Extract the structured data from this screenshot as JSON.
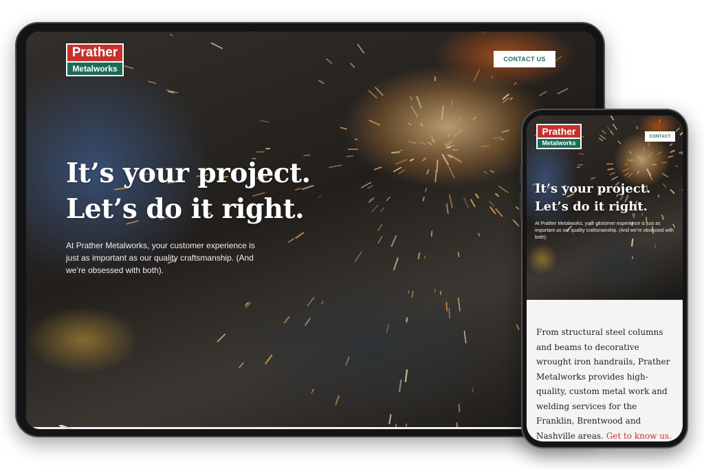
{
  "brand": {
    "name_top": "Prather",
    "name_bottom": "Metalworks",
    "red": "#c5322d",
    "green": "#1c6b57"
  },
  "tablet": {
    "cta_label": "CONTACT US",
    "headline_line1": "It’s your project.",
    "headline_line2": "Let’s do it right.",
    "lead": "At Prather Metalworks, your customer experience is just as important as our quality craftsmanship. (And we’re obsessed with both)."
  },
  "phone": {
    "cta_label": "CONTACT",
    "headline_line1": "It’s your project.",
    "headline_line2": "Let’s do it right.",
    "lead": "At Prather Metalworks, your customer experience is just as important as our quality craftsmanship. (And we’re obsessed with both).",
    "body_text": "From structural steel columns and beams to decorative wrought iron handrails, Prather Metalworks provides high-quality, custom metal work and welding services for the Franklin, Brentwood and Nashville areas.",
    "body_link": "Get to know us."
  }
}
